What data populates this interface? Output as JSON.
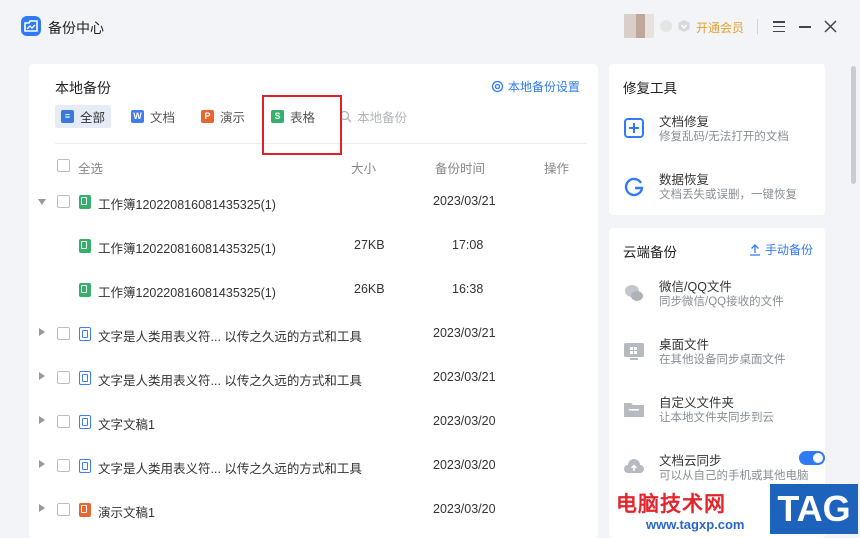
{
  "app": {
    "title": "备份中心"
  },
  "titlebar": {
    "vip_label": "开通会员"
  },
  "local_backup": {
    "title": "本地备份",
    "settings_label": "本地备份设置",
    "tabs": [
      {
        "label": "全部",
        "icon": "list-icon"
      },
      {
        "label": "文档",
        "icon": "word-doc-icon"
      },
      {
        "label": "演示",
        "icon": "ppt-icon"
      },
      {
        "label": "表格",
        "icon": "spreadsheet-icon"
      }
    ],
    "search_placeholder": "本地备份",
    "columns": {
      "select_all": "全选",
      "size": "大小",
      "time": "备份时间",
      "action": "操作"
    },
    "rows": [
      {
        "name": "工作簿120220816081435325(1)",
        "size": "",
        "time": "2023/03/21",
        "type": "xls",
        "expanded": true
      },
      {
        "name": "工作簿120220816081435325(1)",
        "size": "27KB",
        "time": "17:08",
        "type": "xls",
        "child": true
      },
      {
        "name": "工作簿120220816081435325(1)",
        "size": "26KB",
        "time": "16:38",
        "type": "xls",
        "child": true
      },
      {
        "name": "文字是人类用表义符... 以传之久远的方式和工具",
        "size": "",
        "time": "2023/03/21",
        "type": "doc"
      },
      {
        "name": "文字是人类用表义符... 以传之久远的方式和工具",
        "size": "",
        "time": "2023/03/21",
        "type": "doc"
      },
      {
        "name": "文字文稿1",
        "size": "",
        "time": "2023/03/20",
        "type": "doc"
      },
      {
        "name": "文字是人类用表义符... 以传之久远的方式和工具",
        "size": "",
        "time": "2023/03/20",
        "type": "doc"
      },
      {
        "name": "演示文稿1",
        "size": "",
        "time": "2023/03/20",
        "type": "ppt"
      }
    ]
  },
  "repair_tools": {
    "title": "修复工具",
    "items": [
      {
        "title": "文档修复",
        "desc": "修复乱码/无法打开的文档"
      },
      {
        "title": "数据恢复",
        "desc": "文档丢失或误删，一键恢复"
      }
    ]
  },
  "cloud_backup": {
    "title": "云端备份",
    "manual_label": "手动备份",
    "items": [
      {
        "title": "微信/QQ文件",
        "desc": "同步微信/QQ接收的文件"
      },
      {
        "title": "桌面文件",
        "desc": "在其他设备同步桌面文件"
      },
      {
        "title": "自定义文件夹",
        "desc": "让本地文件夹同步到云"
      },
      {
        "title": "文档云同步",
        "desc": "可以从自己的手机或其他电脑"
      }
    ]
  },
  "watermark": {
    "text": "电脑技术网",
    "url": "www.tagxp.com",
    "tag": "TAG"
  },
  "colors": {
    "accent": "#2f7bf6",
    "vip": "#e5a033",
    "highlight": "#e0202a"
  }
}
